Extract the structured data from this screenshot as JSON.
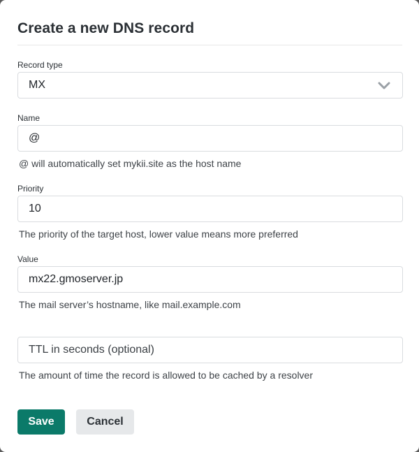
{
  "dialog": {
    "title": "Create a new DNS record"
  },
  "record_type": {
    "label": "Record type",
    "value": "MX",
    "icon": "chevron-down-icon"
  },
  "name": {
    "label": "Name",
    "value": "@",
    "help": "@ will automatically set mykii.site as the host name"
  },
  "priority": {
    "label": "Priority",
    "value": "10",
    "help": "The priority of the target host, lower value means more preferred"
  },
  "value_field": {
    "label": "Value",
    "value": "mx22.gmoserver.jp",
    "help": "The mail server’s hostname, like mail.example.com"
  },
  "ttl": {
    "placeholder": "TTL in seconds (optional)",
    "value": "",
    "help": "The amount of time the record is allowed to be cached by a resolver"
  },
  "actions": {
    "save_label": "Save",
    "cancel_label": "Cancel"
  },
  "colors": {
    "primary": "#0b7a69",
    "secondary": "#e6e8ea",
    "border": "#d9dcdf"
  }
}
